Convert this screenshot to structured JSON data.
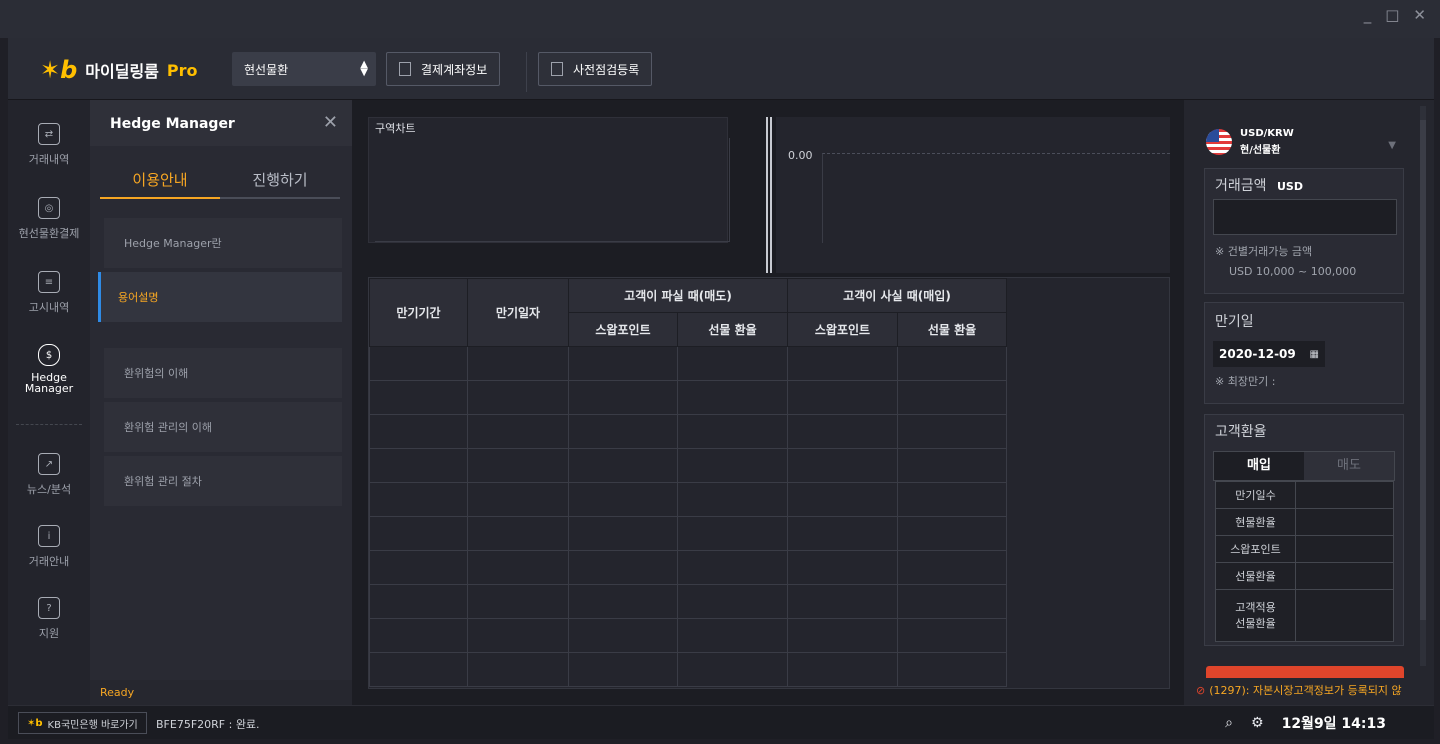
{
  "window": {
    "controls": [
      "_",
      "□",
      "✕"
    ]
  },
  "header": {
    "logo_mark": "✶b",
    "app_name": "마이딜링룸",
    "app_pro": "Pro",
    "product_select": "현선물환",
    "btn_account": "결제계좌정보",
    "btn_precheck": "사전점검등록"
  },
  "nav": [
    {
      "label": "거래내역",
      "icon": "⇄"
    },
    {
      "label": "현선물환결제",
      "icon": "◎"
    },
    {
      "label": "고시내역",
      "icon": "≡"
    },
    {
      "label": "Hedge\nManager",
      "icon": "$"
    },
    {
      "label": "뉴스/분석",
      "icon": "↗"
    },
    {
      "label": "거래안내",
      "icon": "i"
    },
    {
      "label": "지원",
      "icon": "?"
    }
  ],
  "hedge": {
    "title": "Hedge Manager",
    "close": "✕",
    "tabs": [
      "이용안내",
      "진행하기"
    ],
    "items": [
      "Hedge Manager란",
      "용어설명",
      "환위험의 이해",
      "환위험 관리의 이해",
      "환위험 관리 절차"
    ],
    "status": "Ready"
  },
  "chart": {
    "left_title": "구역차트",
    "right_value": "0.00"
  },
  "table": {
    "col_maturity_period": "만기기간",
    "col_maturity_date": "만기일자",
    "group_sell": "고객이 파실 때(매도)",
    "group_buy": "고객이 사실 때(매입)",
    "sub_swap": "스왑포인트",
    "sub_forward": "선물 환율"
  },
  "right": {
    "currency_code": "USD/KRW",
    "currency_type": "현/선물환",
    "amount_title": "거래금액",
    "amount_unit": "USD",
    "amount_note1": "※ 건별거래가능 금액",
    "amount_note2": "USD 10,000 ~ 100,000",
    "maturity_title": "만기일",
    "maturity_date": "2020-12-09",
    "maturity_note": "※ 최장만기 :",
    "rate_title": "고객환율",
    "rate_tabs": [
      "매입",
      "매도"
    ],
    "rate_rows": [
      "만기일수",
      "현물환율",
      "스왑포인트",
      "선물환율",
      "고객적용\n선물환율"
    ],
    "warning": "(1297): 자본시장고객정보가 등록되지 않"
  },
  "footer": {
    "kb_button": "KB국민은행 바로가기",
    "status": "BFE75F20RF : 완료.",
    "datetime": "12월9일 14:13"
  },
  "colors": {
    "accent": "#f6a623",
    "blue": "#2f8be6",
    "danger": "#e0452b"
  }
}
